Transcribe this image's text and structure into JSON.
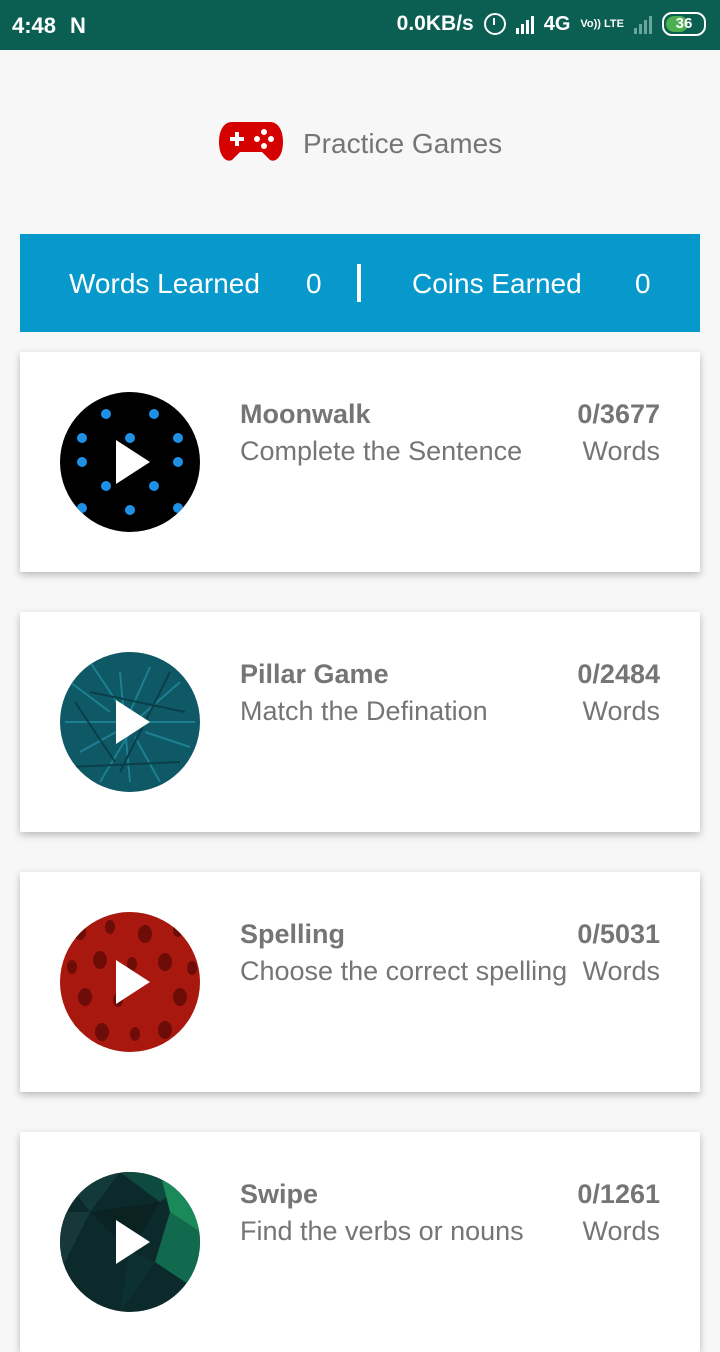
{
  "status_bar": {
    "time": "4:48",
    "notif": "N",
    "speed": "0.0KB/s",
    "network": "4G",
    "volte": "Vo)) LTE",
    "battery": "36"
  },
  "header": {
    "title": "Practice Games"
  },
  "stats": {
    "words_label": "Words Learned",
    "words_value": "0",
    "coins_label": "Coins Earned",
    "coins_value": "0"
  },
  "games": [
    {
      "title": "Moonwalk",
      "subtitle": "Complete the Sentence",
      "count": "0/3677",
      "unit": "Words"
    },
    {
      "title": "Pillar Game",
      "subtitle": "Match the Defination",
      "count": "0/2484",
      "unit": "Words"
    },
    {
      "title": "Spelling",
      "subtitle": "Choose the correct spelling",
      "count": "0/5031",
      "unit": "Words"
    },
    {
      "title": "Swipe",
      "subtitle": "Find the verbs or nouns",
      "count": "0/1261",
      "unit": "Words"
    }
  ],
  "colors": {
    "status": "#0b5e52",
    "accent": "#0799cc",
    "gamepad": "#d50000"
  }
}
